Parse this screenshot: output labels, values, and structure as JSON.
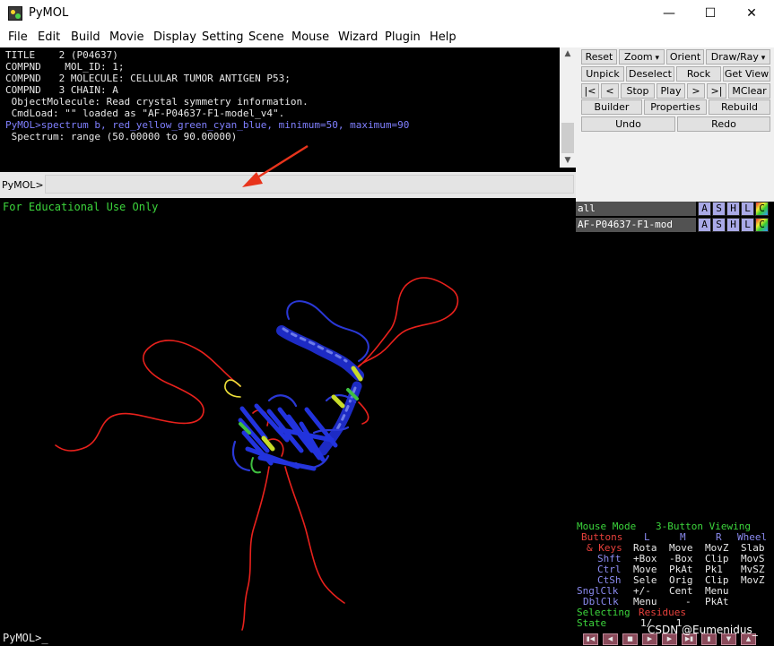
{
  "window": {
    "title": "PyMOL",
    "minimize": "—",
    "maximize": "☐",
    "close": "✕",
    "icon": "pymol-app-icon"
  },
  "menu": [
    "File",
    "Edit",
    "Build",
    "Movie",
    "Display",
    "Setting",
    "Scene",
    "Mouse",
    "Wizard",
    "Plugin",
    "Help"
  ],
  "console": {
    "lines": [
      "TITLE    2 (P04637)",
      "COMPND    MOL_ID: 1;",
      "COMPND   2 MOLECULE: CELLULAR TUMOR ANTIGEN P53;",
      "COMPND   3 CHAIN: A",
      " ObjectMolecule: Read crystal symmetry information.",
      " CmdLoad: \"\" loaded as \"AF-P04637-F1-model_v4\".",
      "PyMOL>spectrum b, red_yellow_green_cyan_blue, minimum=50, maximum=90",
      " Spectrum: range (50.00000 to 90.00000)"
    ]
  },
  "command": {
    "prompt": "PyMOL>",
    "value": ""
  },
  "viewer": {
    "label": "For Educational Use Only",
    "prompt": "PyMOL>_"
  },
  "buttons": {
    "row1": [
      "Reset",
      "Zoom",
      "Orient",
      "Draw/Ray"
    ],
    "row2": [
      "Unpick",
      "Deselect",
      "Rock",
      "Get View"
    ],
    "row3": [
      "|<",
      "<",
      "Stop",
      "Play",
      ">",
      ">|",
      "MClear"
    ],
    "row4": [
      "Builder",
      "Properties",
      "Rebuild"
    ],
    "row5": [
      "Undo",
      "Redo"
    ]
  },
  "objects": [
    {
      "name": "all",
      "buttons": [
        "A",
        "S",
        "H",
        "L",
        "C"
      ]
    },
    {
      "name": "AF-P04637-F1-mod",
      "buttons": [
        "A",
        "S",
        "H",
        "L",
        "C"
      ]
    }
  ],
  "mouse_panel": {
    "mode_title": "Mouse Mode",
    "mode_value": "3-Button Viewing",
    "buttons_label": "Buttons",
    "col_l": "L",
    "col_m": "M",
    "col_r": "R",
    "col_wheel": "Wheel",
    "rows": [
      {
        "key": "& Keys",
        "l": "Rota",
        "m": "Move",
        "r": "MovZ",
        "w": "Slab"
      },
      {
        "key": "Shft",
        "l": "+Box",
        "m": "-Box",
        "r": "Clip",
        "w": "MovS"
      },
      {
        "key": "Ctrl",
        "l": "Move",
        "m": "PkAt",
        "r": "Pk1",
        "w": "MvSZ"
      },
      {
        "key": "CtSh",
        "l": "Sele",
        "m": "Orig",
        "r": "Clip",
        "w": "MovZ"
      },
      {
        "key": "SnglClk",
        "l": "+/-",
        "m": "Cent",
        "r": "Menu",
        "w": ""
      },
      {
        "key": "DblClk",
        "l": "Menu",
        "m": "-",
        "r": "PkAt",
        "w": ""
      }
    ],
    "selecting_label": "Selecting",
    "selecting_value": "Residues",
    "state_label": "State",
    "state_value": "1/    1"
  },
  "watermark": "CSDN @Eumenidus_",
  "colors": {
    "console_bg": "#000000",
    "command_echo": "#8080ff",
    "edu_label": "#3cd53c",
    "object_name_bg": "#525252",
    "object_button": "#a9a9e6",
    "arrow": "#e8341c"
  }
}
